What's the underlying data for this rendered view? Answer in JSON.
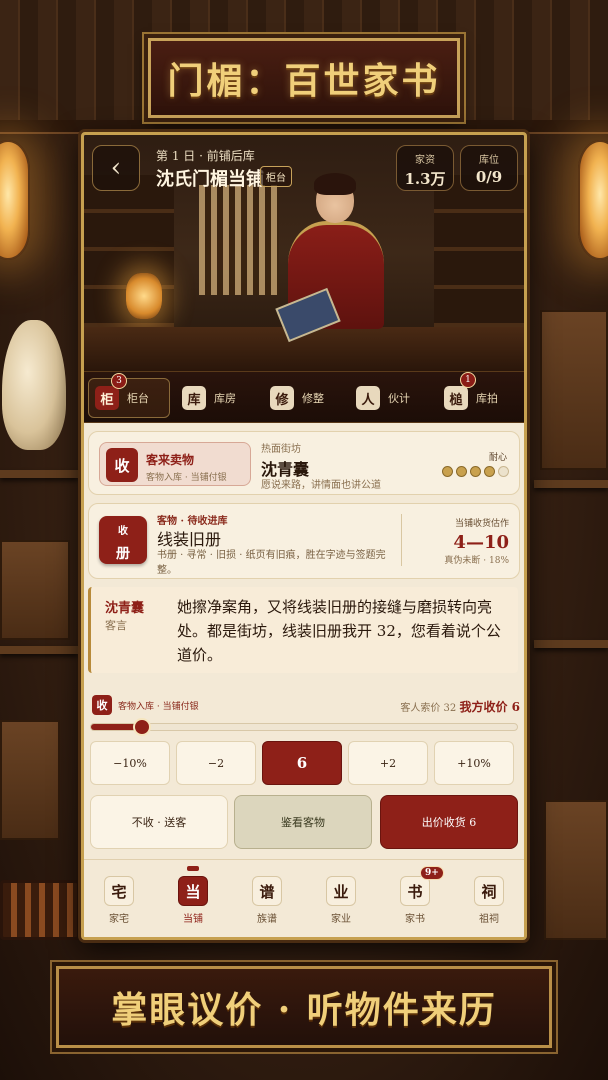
{
  "banner": {
    "title": "门楣：百世家书",
    "slogan": "掌眼议价 · 听物件来历"
  },
  "header": {
    "back_label": "‹",
    "day_line": "第 1 日 · 前铺后库",
    "shop_title": "沈氏门楣当铺",
    "location_tag": "柜台",
    "stats": [
      {
        "label": "家资",
        "value": "1.3万"
      },
      {
        "label": "库位",
        "value": "0/9"
      }
    ]
  },
  "subnav": [
    {
      "glyph": "柜",
      "label": "柜台",
      "badge": "3",
      "active": true
    },
    {
      "glyph": "库",
      "label": "库房",
      "badge": "",
      "active": false
    },
    {
      "glyph": "修",
      "label": "修整",
      "badge": "",
      "active": false
    },
    {
      "glyph": "人",
      "label": "伙计",
      "badge": "",
      "active": false
    },
    {
      "glyph": "槌",
      "label": "库拍",
      "badge": "1",
      "active": false
    }
  ],
  "guest": {
    "mode_glyph": "收",
    "mode_title": "客来卖物",
    "mode_steps": "客物入库 · 当铺付银",
    "tag": "热面街坊",
    "name": "沈青囊",
    "note": "愿说来路，讲情面也讲公道",
    "patience_label": "耐心",
    "patience_total": 5,
    "patience_value": 4
  },
  "item": {
    "box_top": "收",
    "box_bottom": "册",
    "tag": "客物 · 待收进库",
    "name": "线装旧册",
    "desc": "书册 · 寻常 · 旧损 · 纸页有旧痕，胜在字迹与签题完整。",
    "estimate_label": "当铺收货估作",
    "estimate_range": "4—10",
    "estimate_note": "真伪未断 · 18%"
  },
  "speech": {
    "name": "沈青囊",
    "role": "客言",
    "text": "她擦净案角，又将线装旧册的接缝与磨损转向亮处。都是街坊，线装旧册我开 32，您看着说个公道价。"
  },
  "bid": {
    "glyph": "收",
    "steps": "客物入库 · 当铺付银",
    "ask_label": "客人索价 32",
    "offer_label": "我方收价 6",
    "slider_level": 0.12
  },
  "price_buttons": [
    "−10%",
    "−2",
    "6",
    "+2",
    "+10%"
  ],
  "selected_price_index": 2,
  "actions": {
    "refuse": "不收 · 送客",
    "inspect": "鉴看客物",
    "confirm": "出价收货 6"
  },
  "tabs": [
    {
      "glyph": "宅",
      "label": "家宅",
      "badge": "",
      "active": false
    },
    {
      "glyph": "当",
      "label": "当铺",
      "badge": "",
      "active": true
    },
    {
      "glyph": "谱",
      "label": "族谱",
      "badge": "",
      "active": false
    },
    {
      "glyph": "业",
      "label": "家业",
      "badge": "",
      "active": false
    },
    {
      "glyph": "书",
      "label": "家书",
      "badge": "9+",
      "active": false
    },
    {
      "glyph": "祠",
      "label": "祖祠",
      "badge": "",
      "active": false
    }
  ],
  "colors": {
    "accent": "#8e2018",
    "gold": "#c9a14e",
    "paper": "#f8f0e0"
  }
}
